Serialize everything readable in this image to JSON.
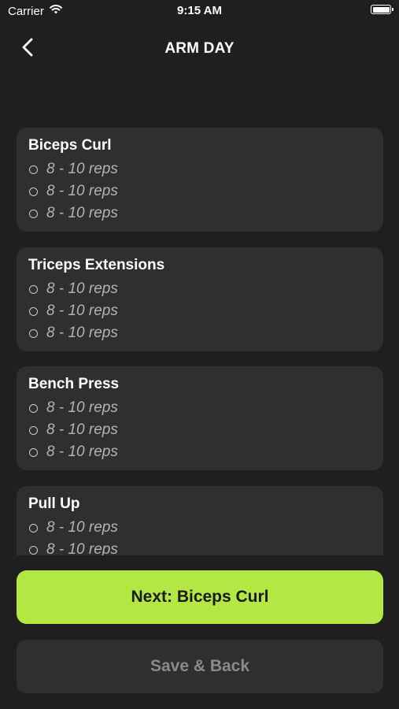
{
  "status_bar": {
    "carrier": "Carrier",
    "time": "9:15 AM",
    "wifi_icon": "wifi-icon",
    "battery_icon": "battery-full-icon"
  },
  "nav": {
    "title": "ARM DAY",
    "back_icon": "chevron-left-icon"
  },
  "exercises": [
    {
      "name": "Biceps Curl",
      "sets": [
        "8 - 10 reps",
        "8 - 10 reps",
        "8 - 10 reps"
      ]
    },
    {
      "name": "Triceps Extensions",
      "sets": [
        "8 - 10 reps",
        "8 - 10 reps",
        "8 - 10 reps"
      ]
    },
    {
      "name": "Bench Press",
      "sets": [
        "8 - 10 reps",
        "8 - 10 reps",
        "8 - 10 reps"
      ]
    },
    {
      "name": "Pull Up",
      "sets": [
        "8 - 10 reps",
        "8 - 10 reps"
      ]
    }
  ],
  "actions": {
    "next_label": "Next: Biceps Curl",
    "save_label": "Save & Back"
  },
  "colors": {
    "background": "#1f1f1f",
    "card": "#2f2f2f",
    "accent": "#b3e844",
    "muted_text": "#8a8a8a"
  }
}
